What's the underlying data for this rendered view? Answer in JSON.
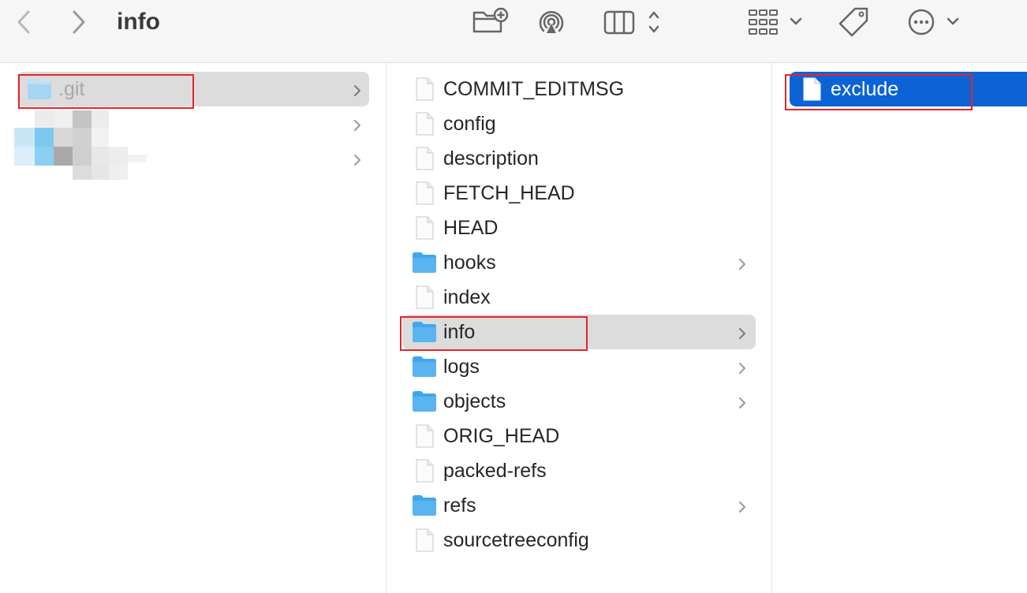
{
  "window": {
    "title": "info"
  },
  "toolbar": {
    "back_icon": "chevron-left-icon",
    "forward_icon": "chevron-right-icon",
    "new_folder_icon": "new-folder-icon",
    "airdrop_icon": "airdrop-icon",
    "view_icon": "column-view-icon",
    "group_icon": "grid-group-icon",
    "tag_icon": "tag-icon",
    "more_icon": "ellipsis-circle-icon"
  },
  "column1": {
    "items": [
      {
        "label": ".git",
        "kind": "folder",
        "selected": true
      },
      {
        "label": "",
        "kind": "redacted"
      },
      {
        "label": "",
        "kind": "redacted"
      }
    ]
  },
  "column2": {
    "items": [
      {
        "label": "COMMIT_EDITMSG",
        "kind": "file"
      },
      {
        "label": "config",
        "kind": "file"
      },
      {
        "label": "description",
        "kind": "file"
      },
      {
        "label": "FETCH_HEAD",
        "kind": "file"
      },
      {
        "label": "HEAD",
        "kind": "file"
      },
      {
        "label": "hooks",
        "kind": "folder"
      },
      {
        "label": "index",
        "kind": "file"
      },
      {
        "label": "info",
        "kind": "folder",
        "selected": true
      },
      {
        "label": "logs",
        "kind": "folder"
      },
      {
        "label": "objects",
        "kind": "folder"
      },
      {
        "label": "ORIG_HEAD",
        "kind": "file"
      },
      {
        "label": "packed-refs",
        "kind": "file"
      },
      {
        "label": "refs",
        "kind": "folder"
      },
      {
        "label": "sourcetreeconfig",
        "kind": "file"
      }
    ]
  },
  "column3": {
    "items": [
      {
        "label": "exclude",
        "kind": "file",
        "selected": true
      }
    ]
  },
  "colors": {
    "selection_blue": "#0b63d6",
    "selection_grey": "#dcdcdc",
    "folder_blue": "#5ab4ef",
    "annotation_red": "#e5252a"
  }
}
